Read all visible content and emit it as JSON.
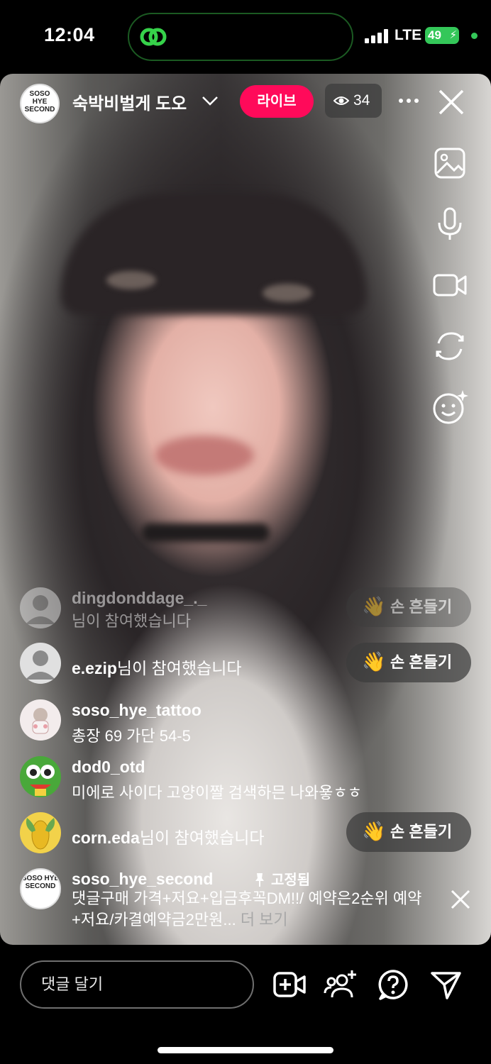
{
  "status_bar": {
    "time": "12:04",
    "network": "LTE",
    "battery": "49"
  },
  "live": {
    "host_name": "숙박비벌게 도오",
    "host_avatar_text": "SOSO HYE SECOND",
    "live_label": "라이브",
    "viewer_count": "34"
  },
  "comments": [
    {
      "username": "dingdonddage_._",
      "text": "님이 참여했습니다",
      "wave_label": "손 흔들기"
    },
    {
      "username": "e.ezip",
      "text": "님이 참여했습니다",
      "wave_label": "손 흔들기"
    },
    {
      "username": "soso_hye_tattoo",
      "text": "총장 69 가단 54-5"
    },
    {
      "username": "dod0_otd",
      "text": "미에로 사이다 고양이짤 검색하믄 나와욯ㅎㅎ"
    },
    {
      "username": "corn.eda",
      "text": "님이 참여했습니다",
      "wave_label": "손 흔들기"
    }
  ],
  "pinned": {
    "username": "soso_hye_second",
    "pinned_label": "고정됨",
    "text": "댓글구매 가격+저요+입금후꼭DM!!/ 예약은2순위 예약+저요/카결예약금2만원...",
    "more_label": "더 보기"
  },
  "bottom_bar": {
    "comment_placeholder": "댓글 달기"
  },
  "colors": {
    "live_badge": "#ff0a5a",
    "battery": "#34c759"
  },
  "icons": [
    "close-icon",
    "more-icon",
    "eye-icon",
    "image-icon",
    "microphone-icon",
    "video-camera-icon",
    "flip-camera-icon",
    "effects-icon",
    "add-video-icon",
    "invite-guest-icon",
    "question-icon",
    "share-icon"
  ]
}
